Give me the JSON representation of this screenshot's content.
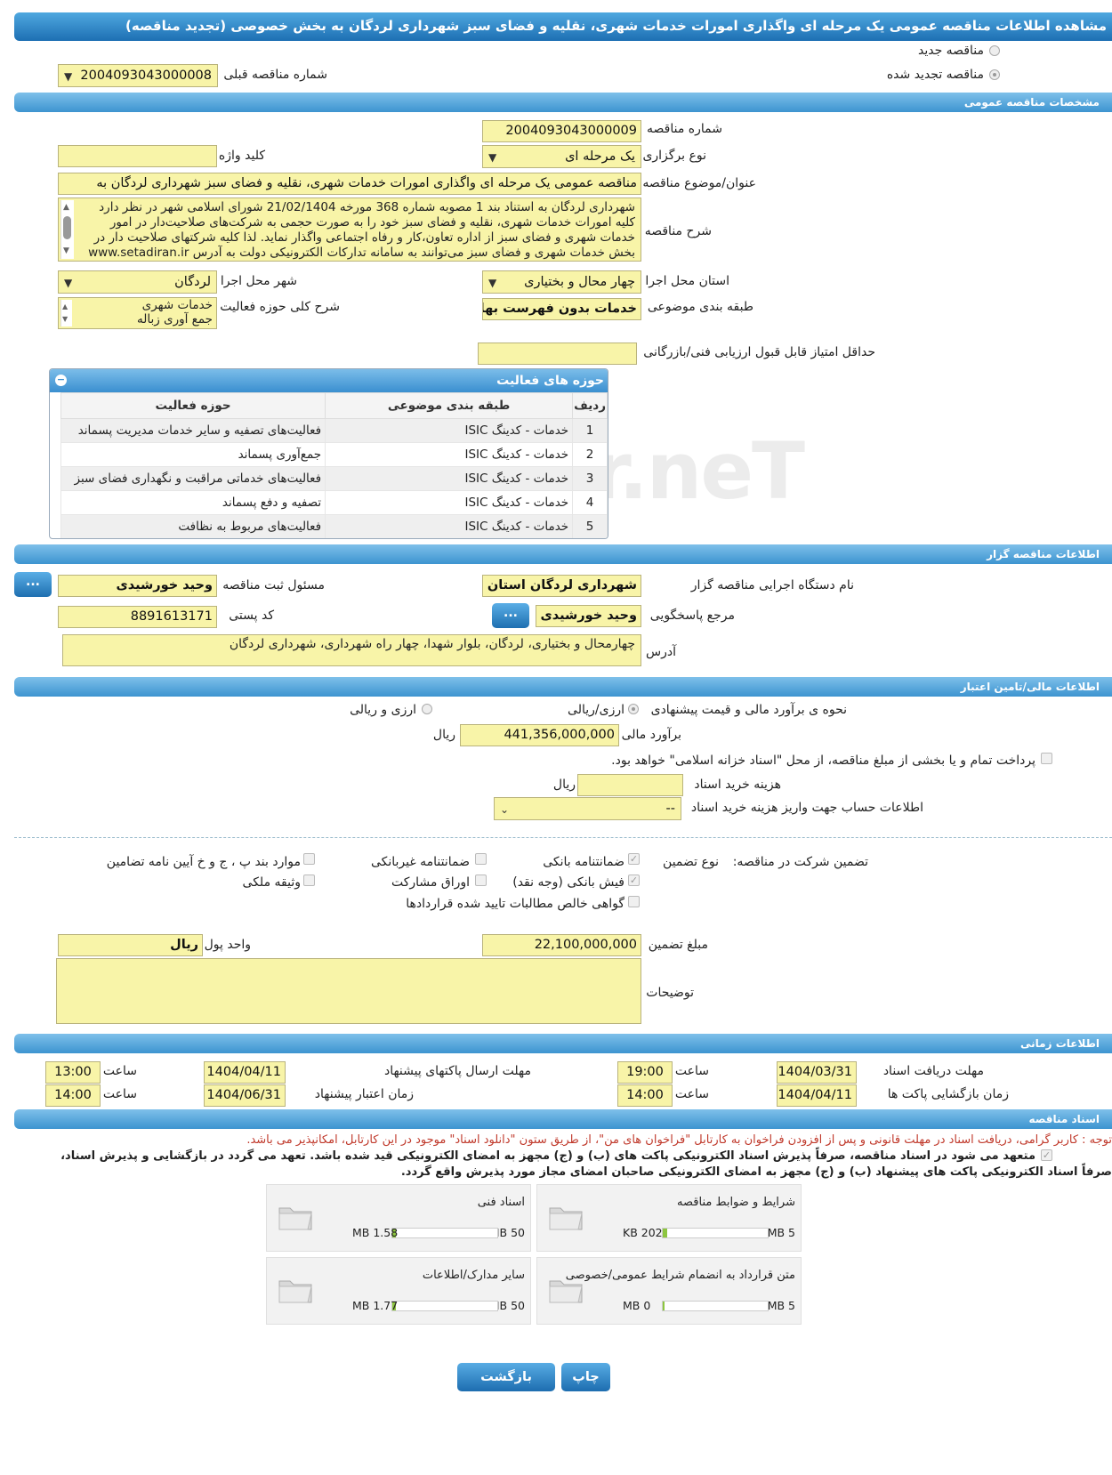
{
  "title": "مشاهده اطلاعات مناقصه عمومی یک مرحله ای واگذاری امورات خدمات شهری، نقلیه و فضای سبز شهرداری لردگان به بخش خصوصی (تجدید مناقصه)",
  "top": {
    "new_tender": "مناقصه جدید",
    "renewed_tender": "مناقصه تجدید شده",
    "prev_number_label": "شماره مناقصه قبلی",
    "prev_number_value": "2004093043000008"
  },
  "general": {
    "header": "مشخصات مناقصه عمومی",
    "number_label": "شماره مناقصه",
    "number_value": "2004093043000009",
    "type_label": "نوع برگزاری",
    "type_value": "یک مرحله ای",
    "keyword_label": "کلید واژه",
    "keyword_value": "",
    "subject_label": "عنوان/موضوع مناقصه",
    "subject_value": "مناقصه عمومی یک مرحله ای واگذاری امورات خدمات شهری،  نقلیه و فضای سبز شهرداری لردگان به",
    "desc_label": "شرح مناقصه",
    "desc_lines": [
      "شهرداری لردگان به استناد بند 1 مصوبه شماره 368 مورخه 21/02/1404 شورای  اسلامی شهر در نظر دارد",
      "کلیه امورات خدمات شهری، نقلیه و فضای سبز خود را به صورت حجمی به شرکت‌های صلاحیت‌دار در امور",
      "خدمات شهری و فضای سبز از اداره تعاون،کار و رفاه اجتماعی واگذار نماید. لذا کلیه شرکتهای صلاحیت دار در",
      "بخش خدمات شهری و فضای سبز می‌توانند به سامانه تدارکات الکترونیکی دولت به آدرس www.setadiran.ir"
    ],
    "province_label": "استان محل اجرا",
    "province_value": "چهار محال و بختیاری",
    "city_label": "شهر محل اجرا",
    "city_value": "لردگان",
    "category_label": "طبقه بندی موضوعی",
    "category_value": "خدمات بدون فهرست بها",
    "activity_desc_label": "شرح کلی حوزه فعالیت",
    "activity_desc_lines": [
      "خدمات شهری",
      "جمع آوری زباله"
    ],
    "min_score_label": "حداقل امتیاز قابل قبول ارزیابی فنی/بازرگانی",
    "min_score_value": ""
  },
  "activity_table": {
    "title": "حوزه های فعالیت",
    "headers": [
      "ردیف",
      "طبقه بندی موضوعی",
      "حوزه فعالیت"
    ],
    "rows": [
      [
        "1",
        "خدمات - کدینگ ISIC",
        "فعالیت‌های تصفیه و سایر خدمات مدیریت پسماند"
      ],
      [
        "2",
        "خدمات - کدینگ ISIC",
        "جمع‌آوری پسماند"
      ],
      [
        "3",
        "خدمات - کدینگ ISIC",
        "فعالیت‌های خدماتی مراقبت و نگهداری فضای سبز"
      ],
      [
        "4",
        "خدمات - کدینگ ISIC",
        "تصفیه و دفع پسماند"
      ],
      [
        "5",
        "خدمات - کدینگ ISIC",
        "فعالیت‌های مربوط به نظافت"
      ]
    ]
  },
  "organizer": {
    "header": "اطلاعات مناقصه گزار",
    "org_label": "نام دستگاه اجرایی مناقصه گزار",
    "org_value": "شهرداری لردگان استان چهار",
    "responsible_label": "مسئول ثبت مناقصه",
    "responsible_value": "وحید خورشیدی",
    "reference_label": "مرجع پاسخگویی",
    "reference_value": "وحید خورشیدی",
    "postal_label": "کد پستی",
    "postal_value": "8891613171",
    "address_label": "آدرس",
    "address_value": "چهارمحال و بختیاری، لردگان، بلوار شهدا، چهار راه شهرداری، شهرداری لردگان",
    "dots": "..."
  },
  "financial": {
    "header": "اطلاعات مالی/تامین اعتبار",
    "estimate_method_label": "نحوه ی برآورد مالی و قیمت پیشنهادی",
    "opt_rial": "ارزی/ریالی",
    "opt_fx": "ارزی و ریالی",
    "estimate_label": "برآورد مالی",
    "estimate_value": "441,356,000,000",
    "rial": "ریال",
    "treasury_text": "پرداخت تمام و یا بخشی از مبلغ مناقصه، از محل \"اسناد خزانه اسلامی\" خواهد بود.",
    "doc_cost_label": "هزینه خرید اسناد",
    "doc_cost_value": "",
    "account_label": "اطلاعات حساب جهت واریز هزینه خرید اسناد",
    "account_value": "--"
  },
  "guarantee": {
    "title": "تضمین شرکت در مناقصه:",
    "type_label": "نوع تضمین",
    "options": {
      "bank": "ضمانتنامه بانکی",
      "nonbank": "ضمانتنامه غیربانکی",
      "items": "موارد بند پ ، ج و خ آیین نامه تضامین",
      "fish": "فیش بانکی (وجه نقد)",
      "bonds": "اوراق مشارکت",
      "property": "وثیقه ملکی",
      "cert": "گواهی خالص مطالبات تایید شده قراردادها"
    },
    "amount_label": "مبلغ تضمین",
    "amount_value": "22,100,000,000",
    "currency_label": "واحد پول",
    "currency_value": "ریال",
    "notes_label": "توضیحات",
    "notes_value": ""
  },
  "timing": {
    "header": "اطلاعات زمانی",
    "doc_receive_label": "مهلت دریافت اسناد",
    "doc_receive_date": "1404/03/31",
    "doc_receive_time": "19:00",
    "send_label": "مهلت ارسال پاکتهای پیشنهاد",
    "send_date": "1404/04/11",
    "send_time": "13:00",
    "open_label": "زمان بازگشایی پاکت ها",
    "open_date": "1404/04/11",
    "open_time": "14:00",
    "validity_label": "زمان اعتبار پیشنهاد",
    "validity_date": "1404/06/31",
    "validity_time": "14:00",
    "time_label": "ساعت"
  },
  "docs": {
    "header": "اسناد مناقصه",
    "notice": "توجه : کاربر گرامی، دریافت اسناد در مهلت قانونی و پس از افزودن فراخوان به کارتابل \"فراخوان های من\"، از طریق ستون \"دانلود اسناد\" موجود در این کارتابل، امکانپذیر می باشد.",
    "commit_line1": "متعهد می شود در اسناد مناقصه، صرفاً پذیرش اسناد الکترونیکی پاکت های (ب) و (ج) مجهز به امضای الکترونیکی قید شده باشد. تعهد می گردد در بازگشایی و پذیرش اسناد،",
    "commit_line2": "صرفاً اسناد الکترونیکی پاکت های پیشنهاد (ب) و (ج) مجهز به امضای الکترونیکی صاحبان امضای مجاز مورد پذیرش واقع گردد.",
    "files": [
      {
        "name": "شرایط و ضوابط مناقصه",
        "max": "5 MB",
        "size": "202 KB",
        "fill": 0.04
      },
      {
        "name": "اسناد فنی",
        "max": "50 MB",
        "size": "1.58 MB",
        "fill": 0.03
      },
      {
        "name": "متن قرارداد به انضمام شرایط عمومی/خصوصی",
        "max": "5 MB",
        "size": "0 MB",
        "fill": 0.0
      },
      {
        "name": "سایر مدارک/اطلاعات",
        "max": "50 MB",
        "size": "1.77 MB",
        "fill": 0.035
      }
    ]
  },
  "footer": {
    "print": "چاپ",
    "back": "بازگشت"
  },
  "watermark": "AriaTender.neT"
}
